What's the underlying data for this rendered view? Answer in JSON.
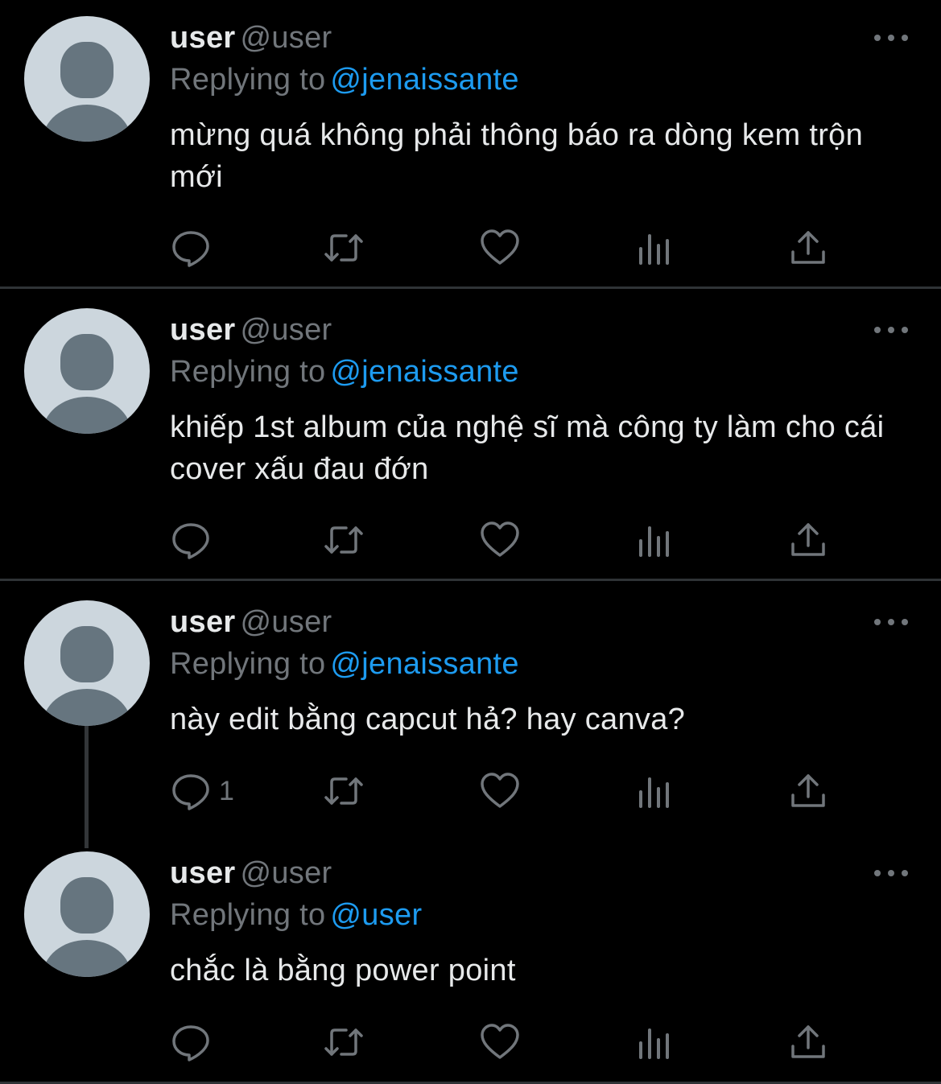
{
  "tweets": [
    {
      "name": "user",
      "handle": "@user",
      "reply_prefix": "Replying to",
      "reply_to": "@jenaissante",
      "text": "mừng quá không phải thông báo ra dòng kem trộn mới",
      "reply_count": ""
    },
    {
      "name": "user",
      "handle": "@user",
      "reply_prefix": "Replying to",
      "reply_to": "@jenaissante",
      "text": "khiếp 1st album của nghệ sĩ mà công ty làm cho cái cover xấu đau đớn",
      "reply_count": ""
    },
    {
      "name": "user",
      "handle": "@user",
      "reply_prefix": "Replying to",
      "reply_to": "@jenaissante",
      "text": "này edit bằng capcut hả? hay canva?",
      "reply_count": "1"
    },
    {
      "name": "user",
      "handle": "@user",
      "reply_prefix": "Replying to",
      "reply_to": "@user",
      "text": "chắc là bằng power point",
      "reply_count": ""
    }
  ],
  "icons": {
    "reply": "reply-icon",
    "retweet": "retweet-icon",
    "like": "heart-icon",
    "views": "views-icon",
    "share": "share-icon",
    "more": "more-icon",
    "avatar": "default-avatar"
  },
  "colors": {
    "background": "#000000",
    "text": "#e7e9ea",
    "muted": "#71767b",
    "link": "#1d9bf0",
    "divider": "#2f3336"
  }
}
